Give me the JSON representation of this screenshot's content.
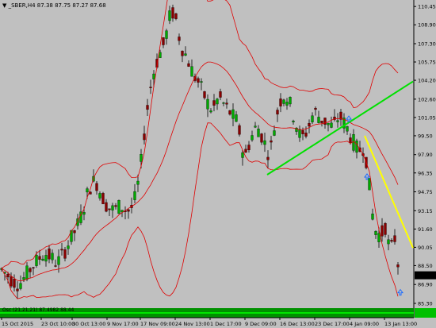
{
  "chart_data": {
    "type": "candlestick",
    "symbol_label": "_SBER,H4",
    "ohlc_header": "87.38 87.75 87.27 87.68",
    "title": "▼ _SBER,H4  87.38 87.75 87.27 87.68",
    "current_price_label": "87.68",
    "y_ticks": [
      "110.45",
      "108.90",
      "107.30",
      "105.75",
      "104.20",
      "102.60",
      "101.05",
      "99.50",
      "97.90",
      "96.35",
      "94.75",
      "93.15",
      "91.60",
      "90.05",
      "88.50",
      "86.90",
      "85.30"
    ],
    "x_ticks": [
      "15 Oct 2015",
      "23 Oct 10:00",
      "30 Oct 13:00",
      "9 Nov 17:00",
      "17 Nov 09:00",
      "24 Nov 13:00",
      "1 Dec 17:00",
      "9 Dec 09:00",
      "16 Dec 13:00",
      "23 Dec 17:00",
      "4 Jan 09:00",
      "13 Jan 13:00"
    ],
    "ylim": [
      85.3,
      111.0
    ],
    "price_path": [
      [
        0,
        88.3
      ],
      [
        8,
        87.8
      ],
      [
        16,
        87.2
      ],
      [
        24,
        86.9
      ],
      [
        32,
        87.6
      ],
      [
        40,
        88.4
      ],
      [
        48,
        89.0
      ],
      [
        56,
        89.6
      ],
      [
        64,
        89.2
      ],
      [
        72,
        88.7
      ],
      [
        80,
        89.5
      ],
      [
        88,
        90.6
      ],
      [
        96,
        91.6
      ],
      [
        104,
        93.0
      ],
      [
        112,
        95.0
      ],
      [
        120,
        95.8
      ],
      [
        128,
        94.5
      ],
      [
        136,
        93.4
      ],
      [
        144,
        93.2
      ],
      [
        152,
        93.6
      ],
      [
        160,
        93.1
      ],
      [
        168,
        93.5
      ],
      [
        176,
        96.0
      ],
      [
        184,
        101.0
      ],
      [
        192,
        104.5
      ],
      [
        200,
        106.2
      ],
      [
        208,
        107.5
      ],
      [
        216,
        110.2
      ],
      [
        222,
        109.3
      ],
      [
        228,
        107.2
      ],
      [
        236,
        106.1
      ],
      [
        244,
        104.7
      ],
      [
        252,
        103.8
      ],
      [
        260,
        102.5
      ],
      [
        268,
        101.6
      ],
      [
        276,
        102.8
      ],
      [
        284,
        102.0
      ],
      [
        292,
        101.3
      ],
      [
        300,
        100.6
      ],
      [
        308,
        97.5
      ],
      [
        316,
        99.2
      ],
      [
        324,
        100.4
      ],
      [
        332,
        99.2
      ],
      [
        340,
        97.8
      ],
      [
        348,
        101.0
      ],
      [
        356,
        103.0
      ],
      [
        364,
        102.6
      ],
      [
        372,
        100.8
      ],
      [
        380,
        99.2
      ],
      [
        388,
        100.0
      ],
      [
        396,
        101.6
      ],
      [
        404,
        101.0
      ],
      [
        412,
        100.6
      ],
      [
        420,
        100.2
      ],
      [
        428,
        101.2
      ],
      [
        436,
        100.4
      ],
      [
        444,
        99.2
      ],
      [
        452,
        98.2
      ],
      [
        460,
        98.6
      ],
      [
        466,
        95.2
      ],
      [
        472,
        91.6
      ],
      [
        480,
        91.0
      ],
      [
        486,
        91.8
      ],
      [
        492,
        89.6
      ],
      [
        498,
        90.8
      ],
      [
        504,
        87.7
      ]
    ],
    "indicator": {
      "name": "Osc (21,21,21) 87.4982 88.44",
      "visible": true
    },
    "trendlines": [
      {
        "color": "#00e000",
        "from": [
          337,
          96.2
        ],
        "to": [
          521,
          104.1
        ]
      },
      {
        "color": "#ffff00",
        "from": [
          460,
          99.5
        ],
        "to": [
          521,
          90.0
        ]
      }
    ],
    "arrows": [
      {
        "x": 440,
        "y": 100.9
      },
      {
        "x": 463,
        "y": 96.0
      },
      {
        "x": 505,
        "y": 86.2
      }
    ],
    "band_color": "#e00000",
    "up_color": "#00aa00",
    "down_color": "#8b0000"
  }
}
